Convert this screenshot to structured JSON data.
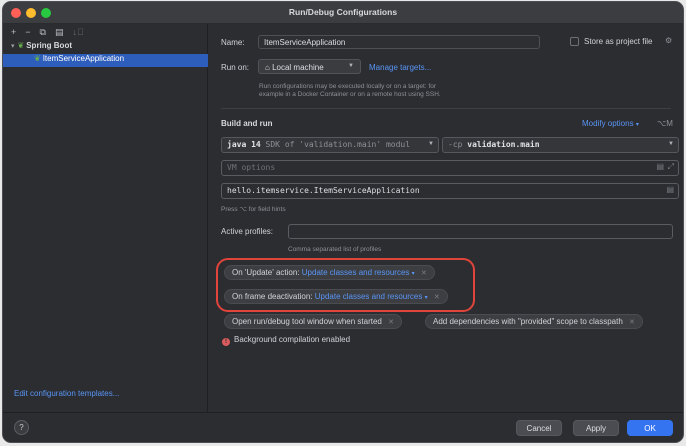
{
  "window": {
    "title": "Run/Debug Configurations"
  },
  "sidebar": {
    "toolbar": {
      "add": "+",
      "remove": "−",
      "copy": "⧉",
      "folder": "▤",
      "sort": "↓⃥"
    },
    "tree": {
      "group_label": "Spring Boot",
      "item_label": "ItemServiceApplication"
    },
    "edit_templates_link": "Edit configuration templates..."
  },
  "form": {
    "name_label": "Name:",
    "name_value": "ItemServiceApplication",
    "store_as_project_file": "Store as project file",
    "run_on_label": "Run on:",
    "run_on_value": "Local machine",
    "manage_targets_link": "Manage targets...",
    "run_on_hint_line1": "Run configurations may be executed locally or on a target: for",
    "run_on_hint_line2": "example in a Docker Container or on a remote host using SSH.",
    "build_and_run_title": "Build and run",
    "modify_options_link": "Modify options",
    "modify_options_shortcut": "⌥M",
    "jdk_version": "java 14",
    "jdk_detail": "SDK of 'validation.main' modul",
    "classpath_flag": "-cp",
    "classpath_value": "validation.main",
    "vm_options_placeholder": "VM options",
    "main_class_value": "hello.itemservice.ItemServiceApplication",
    "field_hints": "Press ⌥ for field hints",
    "active_profiles_label": "Active profiles:",
    "active_profiles_hint": "Comma separated list of profiles",
    "on_update_label": "On 'Update' action:",
    "on_update_value": "Update classes and resources",
    "on_frame_label": "On frame deactivation:",
    "on_frame_value": "Update classes and resources",
    "open_tool_window_tag": "Open run/debug tool window when started",
    "add_dependencies_tag": "Add dependencies with \"provided\" scope to classpath",
    "background_compilation": "Background compilation enabled"
  },
  "footer": {
    "help_label": "?",
    "cancel_label": "Cancel",
    "apply_label": "Apply",
    "ok_label": "OK"
  },
  "colors": {
    "accent": "#3574f0",
    "link": "#5a95f5",
    "highlight_outline": "#e0443b",
    "selection": "#2e5ebc"
  }
}
